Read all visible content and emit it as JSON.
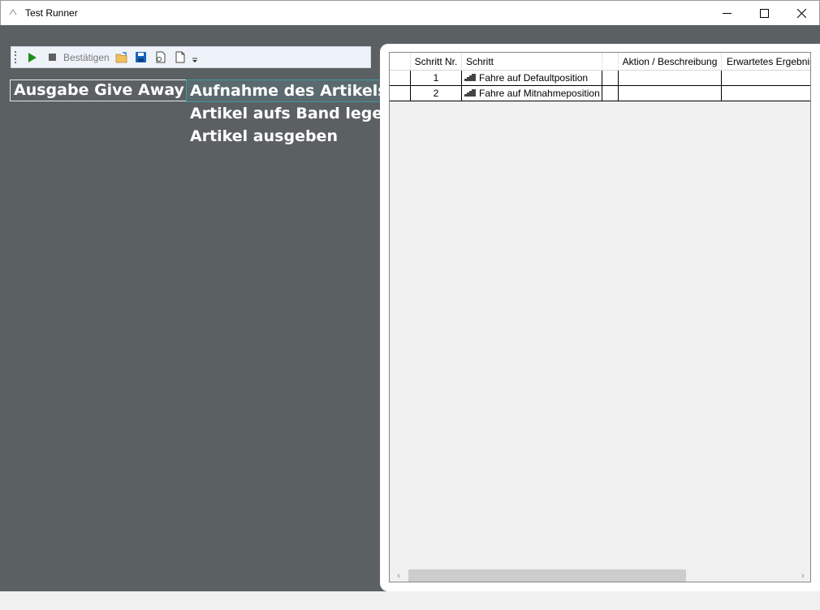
{
  "window": {
    "title": "Test Runner",
    "minimize_glyph": "—",
    "maximize_glyph": "☐",
    "close_glyph": "✕"
  },
  "toolbar": {
    "confirm_label": "Bestätigen",
    "icons": [
      "play-icon",
      "stop-icon",
      "open-folder-icon",
      "save-icon",
      "export-icon",
      "new-file-icon",
      "overflow-icon"
    ],
    "play_color": "#1e8e1e",
    "save_color": "#1565c0"
  },
  "sequence": {
    "title": "Ausgabe Give Away",
    "steps": [
      {
        "label": "Aufnahme des Artikels",
        "selected": true
      },
      {
        "label": "Artikel aufs Band legen",
        "selected": false
      },
      {
        "label": "Artikel ausgeben",
        "selected": false
      }
    ]
  },
  "grid": {
    "columns": [
      "",
      "Schritt Nr.",
      "Schritt",
      "",
      "Aktion / Beschreibung",
      "Erwartetes Ergebnis"
    ],
    "rows": [
      {
        "nr": "1",
        "schritt": "Fahre auf Defaultposition",
        "icon": "step-icon",
        "aktion": "",
        "ergebnis": ""
      },
      {
        "nr": "2",
        "schritt": "Fahre auf Mitnahmeposition",
        "icon": "step-icon",
        "aktion": "",
        "ergebnis": ""
      }
    ],
    "scroll_left_glyph": "‹",
    "scroll_right_glyph": "›"
  },
  "colors": {
    "background": "#5b6062",
    "selection_border": "#3d9aaa"
  }
}
